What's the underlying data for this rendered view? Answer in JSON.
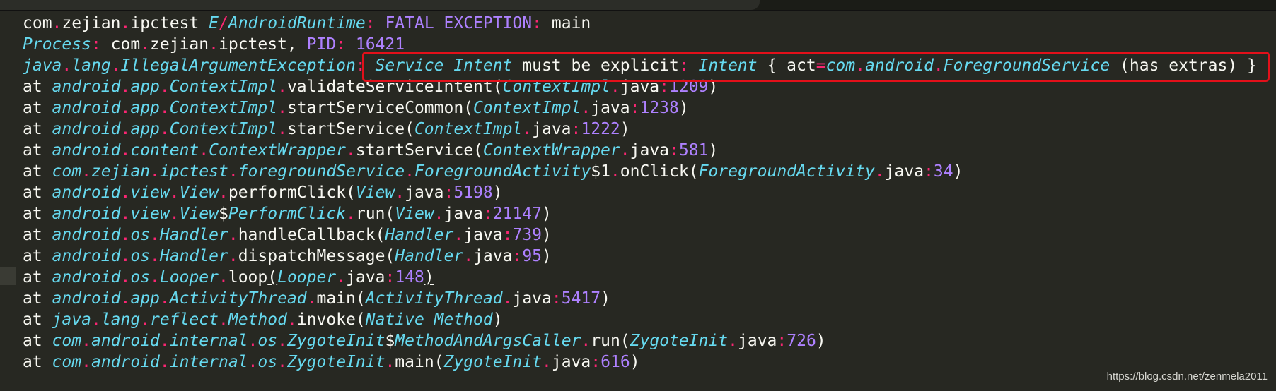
{
  "colors": {
    "background": "#272822",
    "text": "#f8f8f2",
    "class_italic": "#66d9ef",
    "punctuation": "#f92672",
    "number": "#ae81ff",
    "highlight_box": "#e3101a"
  },
  "log_lines": [
    [
      [
        "com",
        "t-default"
      ],
      [
        ".",
        "t-punct"
      ],
      [
        "zejian",
        "t-default"
      ],
      [
        ".",
        "t-punct"
      ],
      [
        "ipctest ",
        "t-default"
      ],
      [
        "E",
        "t-class"
      ],
      [
        "/",
        "t-punct"
      ],
      [
        "AndroidRuntime",
        "t-class"
      ],
      [
        ": ",
        "t-punct"
      ],
      [
        "FATAL EXCEPTION",
        "t-key"
      ],
      [
        ": ",
        "t-punct"
      ],
      [
        "main",
        "t-default"
      ]
    ],
    [
      [
        "Process",
        "t-class"
      ],
      [
        ": ",
        "t-punct"
      ],
      [
        "com",
        "t-default"
      ],
      [
        ".",
        "t-punct"
      ],
      [
        "zejian",
        "t-default"
      ],
      [
        ".",
        "t-punct"
      ],
      [
        "ipctest, ",
        "t-default"
      ],
      [
        "PID",
        "t-key"
      ],
      [
        ": ",
        "t-punct"
      ],
      [
        "16421",
        "t-num"
      ]
    ],
    [
      [
        "java",
        "t-class"
      ],
      [
        ".",
        "t-punct"
      ],
      [
        "lang",
        "t-class"
      ],
      [
        ".",
        "t-punct"
      ],
      [
        "IllegalArgumentException",
        "t-class"
      ],
      [
        ": ",
        "t-punct"
      ],
      [
        "Service Intent",
        "t-class"
      ],
      [
        " must be explicit",
        "t-default"
      ],
      [
        ": ",
        "t-punct"
      ],
      [
        "Intent",
        "t-class"
      ],
      [
        " { act",
        "t-default"
      ],
      [
        "=",
        "t-punct"
      ],
      [
        "com",
        "t-class"
      ],
      [
        ".",
        "t-punct"
      ],
      [
        "android",
        "t-class"
      ],
      [
        ".",
        "t-punct"
      ],
      [
        "ForegroundService",
        "t-class"
      ],
      [
        " (has extras) }",
        "t-default"
      ]
    ],
    [
      [
        "at ",
        "t-default"
      ],
      [
        "android",
        "t-class"
      ],
      [
        ".",
        "t-punct"
      ],
      [
        "app",
        "t-class"
      ],
      [
        ".",
        "t-punct"
      ],
      [
        "ContextImpl",
        "t-class"
      ],
      [
        ".",
        "t-punct"
      ],
      [
        "validateServiceIntent(",
        "t-default"
      ],
      [
        "ContextImpl",
        "t-class"
      ],
      [
        ".",
        "t-punct"
      ],
      [
        "java",
        "t-default"
      ],
      [
        ":",
        "t-punct"
      ],
      [
        "1209",
        "t-num"
      ],
      [
        ")",
        "t-default"
      ]
    ],
    [
      [
        "at ",
        "t-default"
      ],
      [
        "android",
        "t-class"
      ],
      [
        ".",
        "t-punct"
      ],
      [
        "app",
        "t-class"
      ],
      [
        ".",
        "t-punct"
      ],
      [
        "ContextImpl",
        "t-class"
      ],
      [
        ".",
        "t-punct"
      ],
      [
        "startServiceCommon(",
        "t-default"
      ],
      [
        "ContextImpl",
        "t-class"
      ],
      [
        ".",
        "t-punct"
      ],
      [
        "java",
        "t-default"
      ],
      [
        ":",
        "t-punct"
      ],
      [
        "1238",
        "t-num"
      ],
      [
        ")",
        "t-default"
      ]
    ],
    [
      [
        "at ",
        "t-default"
      ],
      [
        "android",
        "t-class"
      ],
      [
        ".",
        "t-punct"
      ],
      [
        "app",
        "t-class"
      ],
      [
        ".",
        "t-punct"
      ],
      [
        "ContextImpl",
        "t-class"
      ],
      [
        ".",
        "t-punct"
      ],
      [
        "startService(",
        "t-default"
      ],
      [
        "ContextImpl",
        "t-class"
      ],
      [
        ".",
        "t-punct"
      ],
      [
        "java",
        "t-default"
      ],
      [
        ":",
        "t-punct"
      ],
      [
        "1222",
        "t-num"
      ],
      [
        ")",
        "t-default"
      ]
    ],
    [
      [
        "at ",
        "t-default"
      ],
      [
        "android",
        "t-class"
      ],
      [
        ".",
        "t-punct"
      ],
      [
        "content",
        "t-class"
      ],
      [
        ".",
        "t-punct"
      ],
      [
        "ContextWrapper",
        "t-class"
      ],
      [
        ".",
        "t-punct"
      ],
      [
        "startService(",
        "t-default"
      ],
      [
        "ContextWrapper",
        "t-class"
      ],
      [
        ".",
        "t-punct"
      ],
      [
        "java",
        "t-default"
      ],
      [
        ":",
        "t-punct"
      ],
      [
        "581",
        "t-num"
      ],
      [
        ")",
        "t-default"
      ]
    ],
    [
      [
        "at ",
        "t-default"
      ],
      [
        "com",
        "t-class"
      ],
      [
        ".",
        "t-punct"
      ],
      [
        "zejian",
        "t-class"
      ],
      [
        ".",
        "t-punct"
      ],
      [
        "ipctest",
        "t-class"
      ],
      [
        ".",
        "t-punct"
      ],
      [
        "foregroundService",
        "t-class"
      ],
      [
        ".",
        "t-punct"
      ],
      [
        "ForegroundActivity",
        "t-class"
      ],
      [
        "$1",
        "t-default"
      ],
      [
        ".",
        "t-punct"
      ],
      [
        "onClick(",
        "t-default"
      ],
      [
        "ForegroundActivity",
        "t-class"
      ],
      [
        ".",
        "t-punct"
      ],
      [
        "java",
        "t-default"
      ],
      [
        ":",
        "t-punct"
      ],
      [
        "34",
        "t-num"
      ],
      [
        ")",
        "t-default"
      ]
    ],
    [
      [
        "at ",
        "t-default"
      ],
      [
        "android",
        "t-class"
      ],
      [
        ".",
        "t-punct"
      ],
      [
        "view",
        "t-class"
      ],
      [
        ".",
        "t-punct"
      ],
      [
        "View",
        "t-class"
      ],
      [
        ".",
        "t-punct"
      ],
      [
        "performClick(",
        "t-default"
      ],
      [
        "View",
        "t-class"
      ],
      [
        ".",
        "t-punct"
      ],
      [
        "java",
        "t-default"
      ],
      [
        ":",
        "t-punct"
      ],
      [
        "5198",
        "t-num"
      ],
      [
        ")",
        "t-default"
      ]
    ],
    [
      [
        "at ",
        "t-default"
      ],
      [
        "android",
        "t-class"
      ],
      [
        ".",
        "t-punct"
      ],
      [
        "view",
        "t-class"
      ],
      [
        ".",
        "t-punct"
      ],
      [
        "View",
        "t-class"
      ],
      [
        "$",
        "t-default"
      ],
      [
        "PerformClick",
        "t-class"
      ],
      [
        ".",
        "t-punct"
      ],
      [
        "run(",
        "t-default"
      ],
      [
        "View",
        "t-class"
      ],
      [
        ".",
        "t-punct"
      ],
      [
        "java",
        "t-default"
      ],
      [
        ":",
        "t-punct"
      ],
      [
        "21147",
        "t-num"
      ],
      [
        ")",
        "t-default"
      ]
    ],
    [
      [
        "at ",
        "t-default"
      ],
      [
        "android",
        "t-class"
      ],
      [
        ".",
        "t-punct"
      ],
      [
        "os",
        "t-class"
      ],
      [
        ".",
        "t-punct"
      ],
      [
        "Handler",
        "t-class"
      ],
      [
        ".",
        "t-punct"
      ],
      [
        "handleCallback(",
        "t-default"
      ],
      [
        "Handler",
        "t-class"
      ],
      [
        ".",
        "t-punct"
      ],
      [
        "java",
        "t-default"
      ],
      [
        ":",
        "t-punct"
      ],
      [
        "739",
        "t-num"
      ],
      [
        ")",
        "t-default"
      ]
    ],
    [
      [
        "at ",
        "t-default"
      ],
      [
        "android",
        "t-class"
      ],
      [
        ".",
        "t-punct"
      ],
      [
        "os",
        "t-class"
      ],
      [
        ".",
        "t-punct"
      ],
      [
        "Handler",
        "t-class"
      ],
      [
        ".",
        "t-punct"
      ],
      [
        "dispatchMessage(",
        "t-default"
      ],
      [
        "Handler",
        "t-class"
      ],
      [
        ".",
        "t-punct"
      ],
      [
        "java",
        "t-default"
      ],
      [
        ":",
        "t-punct"
      ],
      [
        "95",
        "t-num"
      ],
      [
        ")",
        "t-default"
      ]
    ],
    [
      [
        "at ",
        "t-default"
      ],
      [
        "android",
        "t-class"
      ],
      [
        ".",
        "t-punct"
      ],
      [
        "os",
        "t-class"
      ],
      [
        ".",
        "t-punct"
      ],
      [
        "Looper",
        "t-class"
      ],
      [
        ".",
        "t-punct"
      ],
      [
        "loop",
        "t-default"
      ],
      [
        "(",
        "t-default t-underline"
      ],
      [
        "Looper",
        "t-class"
      ],
      [
        ".",
        "t-punct"
      ],
      [
        "java",
        "t-default"
      ],
      [
        ":",
        "t-punct"
      ],
      [
        "148",
        "t-num"
      ],
      [
        ")",
        "t-default t-underline"
      ]
    ],
    [
      [
        "at ",
        "t-default"
      ],
      [
        "android",
        "t-class"
      ],
      [
        ".",
        "t-punct"
      ],
      [
        "app",
        "t-class"
      ],
      [
        ".",
        "t-punct"
      ],
      [
        "ActivityThread",
        "t-class"
      ],
      [
        ".",
        "t-punct"
      ],
      [
        "main(",
        "t-default"
      ],
      [
        "ActivityThread",
        "t-class"
      ],
      [
        ".",
        "t-punct"
      ],
      [
        "java",
        "t-default"
      ],
      [
        ":",
        "t-punct"
      ],
      [
        "5417",
        "t-num"
      ],
      [
        ")",
        "t-default"
      ]
    ],
    [
      [
        "at ",
        "t-default"
      ],
      [
        "java",
        "t-class"
      ],
      [
        ".",
        "t-punct"
      ],
      [
        "lang",
        "t-class"
      ],
      [
        ".",
        "t-punct"
      ],
      [
        "reflect",
        "t-class"
      ],
      [
        ".",
        "t-punct"
      ],
      [
        "Method",
        "t-class"
      ],
      [
        ".",
        "t-punct"
      ],
      [
        "invoke(",
        "t-default"
      ],
      [
        "Native Method",
        "t-class"
      ],
      [
        ")",
        "t-default"
      ]
    ],
    [
      [
        "at ",
        "t-default"
      ],
      [
        "com",
        "t-class"
      ],
      [
        ".",
        "t-punct"
      ],
      [
        "android",
        "t-class"
      ],
      [
        ".",
        "t-punct"
      ],
      [
        "internal",
        "t-class"
      ],
      [
        ".",
        "t-punct"
      ],
      [
        "os",
        "t-class"
      ],
      [
        ".",
        "t-punct"
      ],
      [
        "ZygoteInit",
        "t-class"
      ],
      [
        "$",
        "t-default"
      ],
      [
        "MethodAndArgsCaller",
        "t-class"
      ],
      [
        ".",
        "t-punct"
      ],
      [
        "run(",
        "t-default"
      ],
      [
        "ZygoteInit",
        "t-class"
      ],
      [
        ".",
        "t-punct"
      ],
      [
        "java",
        "t-default"
      ],
      [
        ":",
        "t-punct"
      ],
      [
        "726",
        "t-num"
      ],
      [
        ")",
        "t-default"
      ]
    ],
    [
      [
        "at ",
        "t-default"
      ],
      [
        "com",
        "t-class"
      ],
      [
        ".",
        "t-punct"
      ],
      [
        "android",
        "t-class"
      ],
      [
        ".",
        "t-punct"
      ],
      [
        "internal",
        "t-class"
      ],
      [
        ".",
        "t-punct"
      ],
      [
        "os",
        "t-class"
      ],
      [
        ".",
        "t-punct"
      ],
      [
        "ZygoteInit",
        "t-class"
      ],
      [
        ".",
        "t-punct"
      ],
      [
        "main(",
        "t-default"
      ],
      [
        "ZygoteInit",
        "t-class"
      ],
      [
        ".",
        "t-punct"
      ],
      [
        "java",
        "t-default"
      ],
      [
        ":",
        "t-punct"
      ],
      [
        "616",
        "t-num"
      ],
      [
        ")",
        "t-default"
      ]
    ]
  ],
  "watermark": "https://blog.csdn.net/zenmela2011"
}
